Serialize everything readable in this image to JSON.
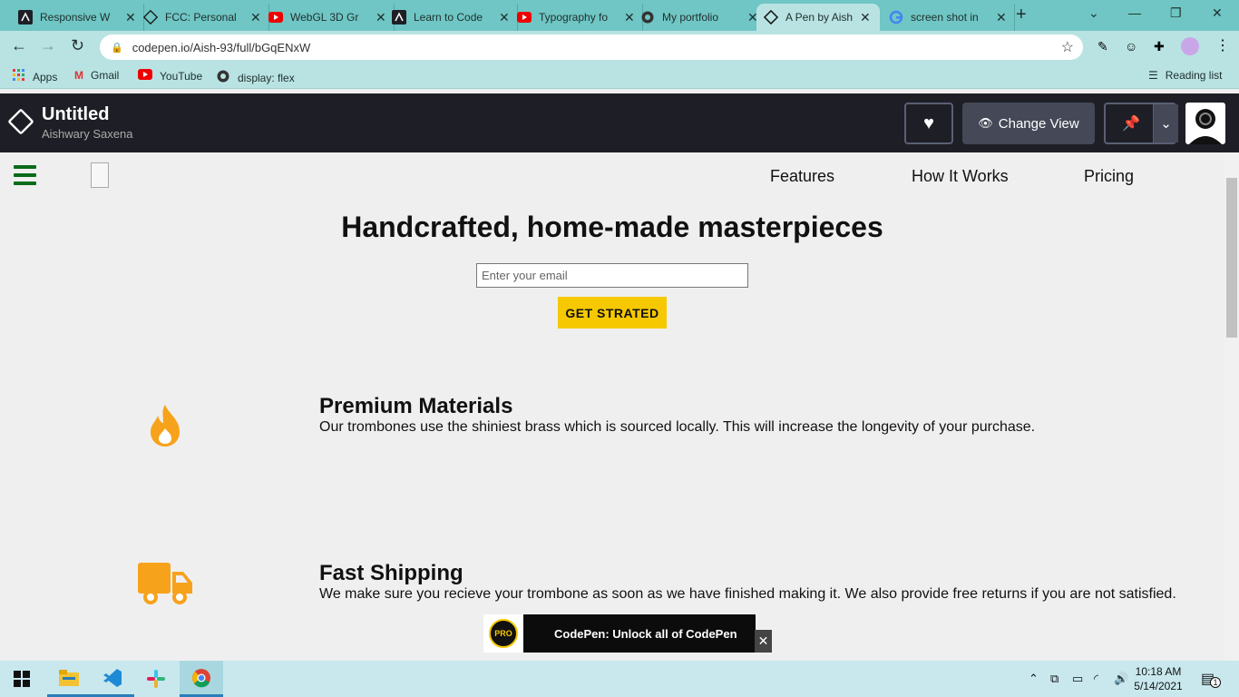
{
  "browser": {
    "tabs": [
      {
        "title": "Responsive W",
        "icon": "codepen-square-icon"
      },
      {
        "title": "FCC: Personal",
        "icon": "codepen-icon"
      },
      {
        "title": "WebGL 3D Gr",
        "icon": "youtube-icon"
      },
      {
        "title": "Learn to Code",
        "icon": "codepen-square-icon"
      },
      {
        "title": "Typography fo",
        "icon": "youtube-icon"
      },
      {
        "title": "My portfolio",
        "icon": "globe-icon"
      },
      {
        "title": "A Pen by Aish",
        "icon": "codepen-icon",
        "active": true
      },
      {
        "title": "screen shot in",
        "icon": "google-icon"
      }
    ],
    "url": "codepen.io/Aish-93/full/bGqENxW",
    "bookmarks": [
      {
        "label": "Apps",
        "icon": "apps-grid-icon"
      },
      {
        "label": "Gmail",
        "icon": "gmail-icon"
      },
      {
        "label": "YouTube",
        "icon": "youtube-icon"
      },
      {
        "label": "display: flex",
        "icon": "globe-icon"
      }
    ],
    "reading_list": "Reading list"
  },
  "codepen": {
    "title": "Untitled",
    "author": "Aishwary Saxena",
    "change_view": "Change View"
  },
  "page": {
    "nav": {
      "features": "Features",
      "how": "How It Works",
      "pricing": "Pricing"
    },
    "hero_title": "Handcrafted, home-made masterpieces",
    "email_placeholder": "Enter your email",
    "cta": "GET STRATED",
    "features": [
      {
        "title": "Premium Materials",
        "desc": "Our trombones use the shiniest brass which is sourced locally. This will increase the longevity of your purchase.",
        "icon": "fire-icon"
      },
      {
        "title": "Fast Shipping",
        "desc": "We make sure you recieve your trombone as soon as we have finished making it. We also provide free returns if you are not satisfied.",
        "icon": "truck-icon"
      }
    ]
  },
  "promo": {
    "badge": "PRO",
    "text": "CodePen: Unlock all of CodePen"
  },
  "taskbar": {
    "time": "10:18 AM",
    "date": "5/14/2021",
    "notifications": "1"
  },
  "colors": {
    "accent_yellow": "#f6c800",
    "icon_orange": "#f7a21b",
    "hamburger_green": "#0a6b1a",
    "tab_bar": "#6fc6c4"
  }
}
